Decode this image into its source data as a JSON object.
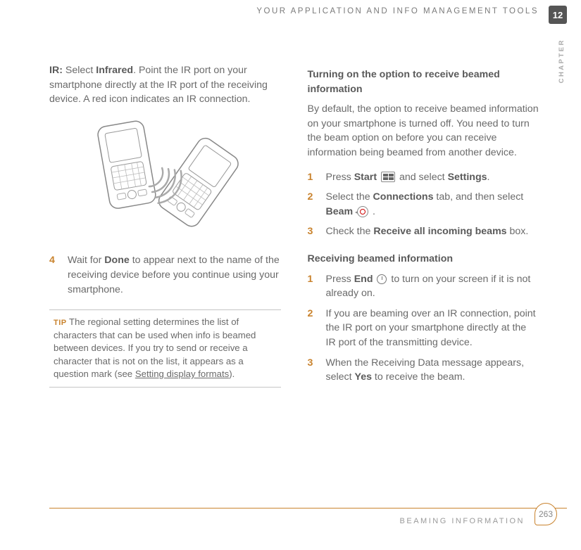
{
  "header": {
    "title": "YOUR APPLICATION AND INFO MANAGEMENT TOOLS",
    "chapter_num": "12",
    "chapter_word": "CHAPTER"
  },
  "left": {
    "ir_intro_prefix": "IR:",
    "ir_intro_body": " Select ",
    "ir_intro_bold1": "Infrared",
    "ir_intro_rest": ". Point the IR port on your smartphone directly at the IR port of the receiving device. A red icon indicates an IR connection.",
    "step4_num": "4",
    "step4_a": "Wait for ",
    "step4_bold": "Done",
    "step4_b": " to appear next to the name of the receiving device before you continue using your smartphone.",
    "tip_label": "TIP",
    "tip_a": " The regional setting determines the list of characters that can be used when info is beamed between devices. If you try to send or receive a character that is not on the list, it appears as a question mark (see ",
    "tip_link": "Setting display formats",
    "tip_b": ")."
  },
  "right": {
    "sec1_title": "Turning on the option to receive beamed information",
    "sec1_para": "By default, the option to receive beamed information on your smartphone is turned off. You need to turn the beam option on before you can receive information being beamed from another device.",
    "s1n": "1",
    "s1a": "Press ",
    "s1b": "Start",
    "s1c": " and select ",
    "s1d": "Settings",
    "s1e": ".",
    "s2n": "2",
    "s2a": "Select the ",
    "s2b": "Connections",
    "s2c": " tab, and then select ",
    "s2d": "Beam",
    "s2e": " .",
    "s3n": "3",
    "s3a": "Check the ",
    "s3b": "Receive all incoming beams",
    "s3c": " box.",
    "sec2_title": "Receiving beamed information",
    "r1n": "1",
    "r1a": "Press ",
    "r1b": "End",
    "r1c": " to turn on your screen if it is not already on.",
    "r2n": "2",
    "r2": "If you are beaming over an IR connection, point the IR port on your smartphone directly at the IR port of the transmitting device.",
    "r3n": "3",
    "r3a": "When the Receiving Data message appears, select ",
    "r3b": "Yes",
    "r3c": " to receive the beam."
  },
  "footer": {
    "title": "BEAMING INFORMATION",
    "page": "263"
  }
}
